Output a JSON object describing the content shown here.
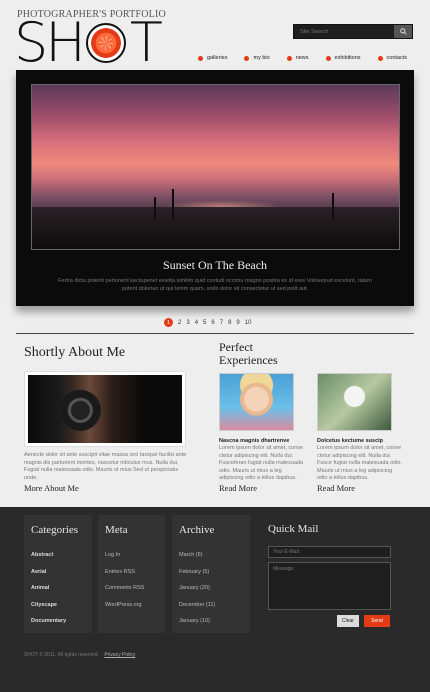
{
  "header": {
    "tagline": "PHOTOGRAPHER'S PORTFOLIO",
    "logo_left": "SH",
    "logo_right": "T",
    "search_placeholder": "Site Search"
  },
  "nav": {
    "items": [
      {
        "label": "galleries"
      },
      {
        "label": "my bio"
      },
      {
        "label": "news"
      },
      {
        "label": "exhibitions"
      },
      {
        "label": "contacts"
      }
    ]
  },
  "slider": {
    "title": "Sunset On The Beach",
    "text": "Fertra dictu potenti pertunent kectupenet exietta similim quid contudi occimu magno positra ex id eres Volouepud excelunt, ratum potent dolorian ut qui tenim quam, sodo dolor sit consectetur ut sed pelit aut.",
    "pages": [
      "1",
      "2",
      "3",
      "4",
      "5",
      "6",
      "7",
      "8",
      "9",
      "10"
    ],
    "active_page": "1"
  },
  "about": {
    "title": "Shortly About Me",
    "text": "Aenecte dolor sit ante suscipit vitae massa orci tacique facilisi ante magnis dis parturient montes, nascetur ridiculus mus. Nulla dui, Fugiat nulla malesuada odio. Mauris ut mius Sed ut perspiciatis unde.",
    "more": "More About Me"
  },
  "experiences": {
    "title_line1": "Perfect",
    "title_line2": "Experiences",
    "items": [
      {
        "heading": "Nascna magnis dhartrenve",
        "text": "Lorem ipsum dolor sit amet, conse ctetur adipiscing elit. Nulla dui. Fusceferan fugiat nulla malesuada odio. Mauris ut mius a leg adipiscing odio a tellus dapibus.",
        "more": "Read More"
      },
      {
        "heading": "Dolcetus kectume suscip",
        "text": "Lorem ipsum dolor sit amet, conse ctetur adipiscing elit. Nulla dui. Fusce fugiat nulla malesuada odio. Mauris ut mius a leg adipiscing odio a tellus dapibus.",
        "more": "Read More"
      }
    ]
  },
  "footer": {
    "categories": {
      "title": "Categories",
      "items": [
        "Abstract",
        "Aerial",
        "Animal",
        "Cityscape",
        "Documentary"
      ]
    },
    "meta": {
      "title": "Meta",
      "items": [
        "Log In",
        "Entries RSS",
        "Comments RSS",
        "WordPress.org"
      ]
    },
    "archive": {
      "title": "Archive",
      "items": [
        "March (6)",
        "February (5)",
        "January (20)",
        "December (11)",
        "January (10)"
      ]
    },
    "quickmail": {
      "title": "Quick Mail",
      "email_placeholder": "Your E-Mail:",
      "message_placeholder": "Message:",
      "clear": "Clear",
      "send": "Send"
    },
    "copyright": "SHOT © 2011. All rights reserved.",
    "privacy": "Privacy Policy"
  },
  "colors": {
    "accent": "#e43a16",
    "footer_bg": "#2a2a2a",
    "page_bg": "#eeeeee"
  }
}
